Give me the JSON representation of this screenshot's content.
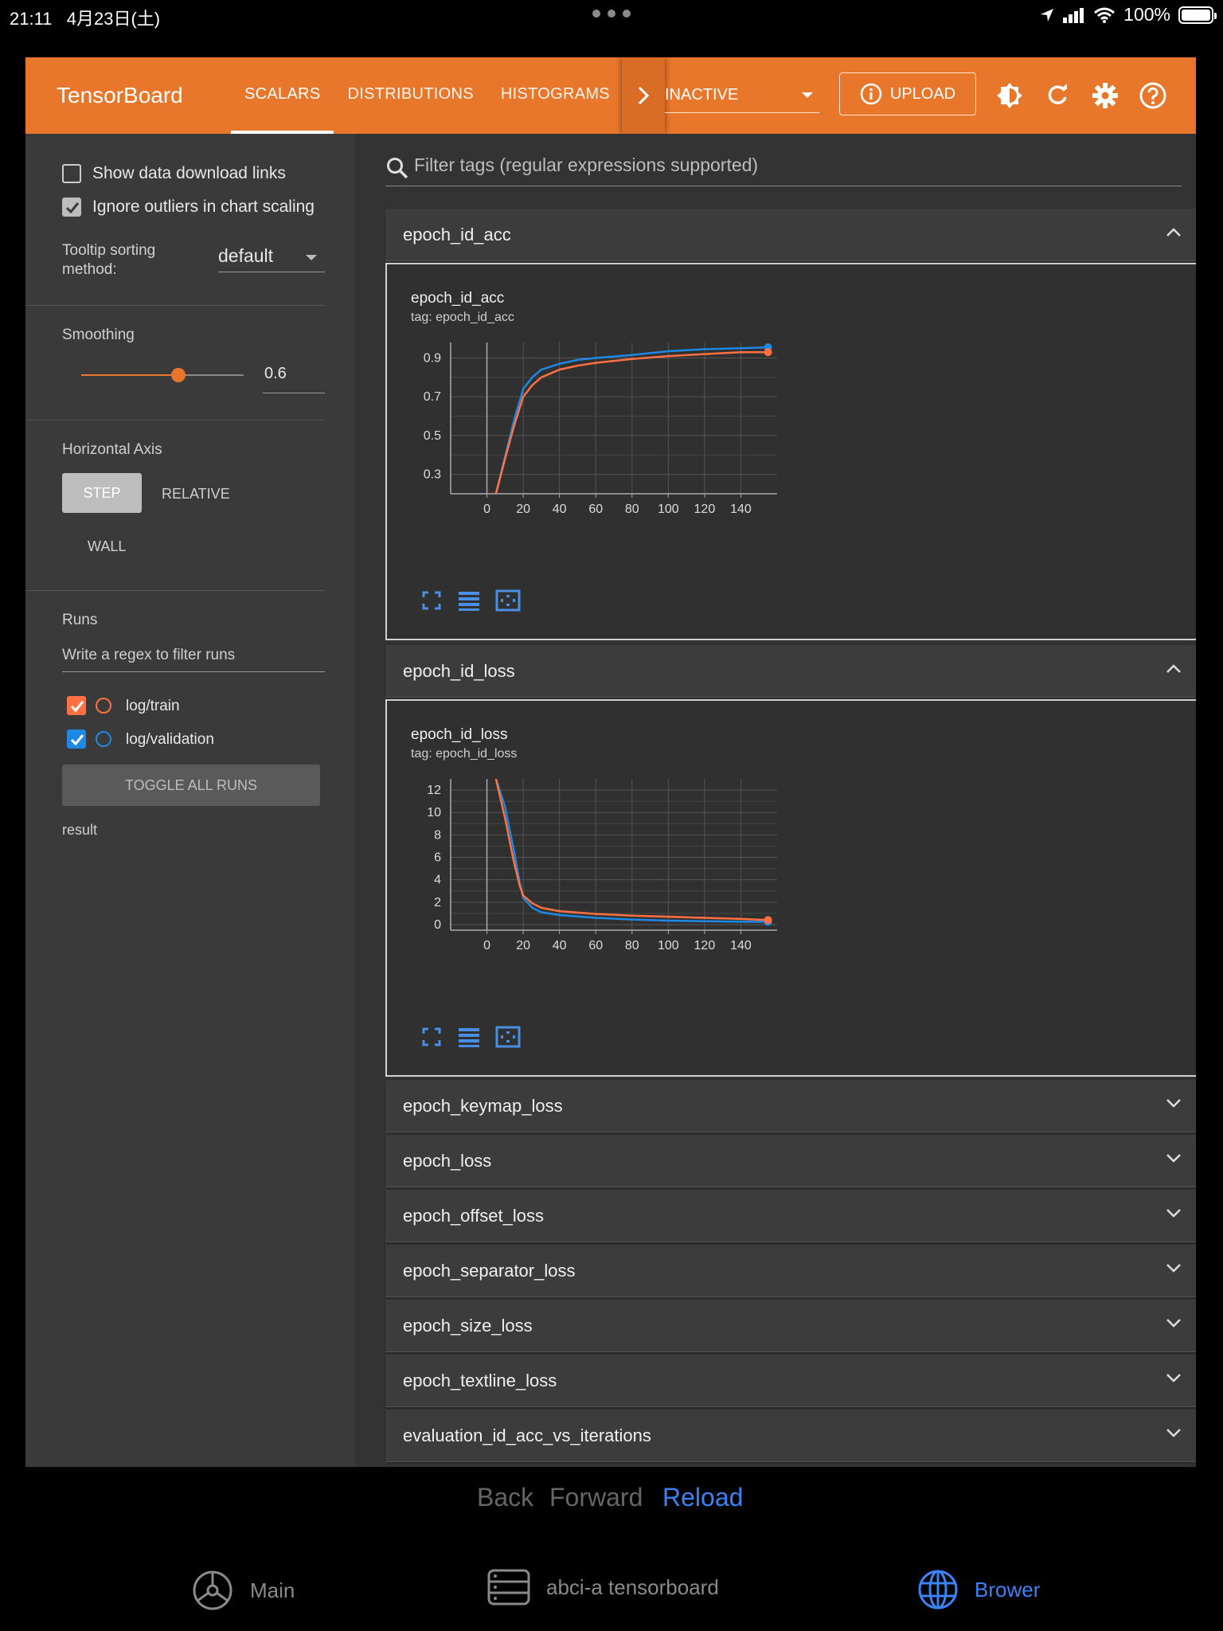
{
  "status_bar": {
    "time": "21:11",
    "date": "4月23日(土)",
    "battery": "100%"
  },
  "app": {
    "brand": "TensorBoard",
    "tabs": [
      {
        "label": "SCALARS",
        "active": true
      },
      {
        "label": "DISTRIBUTIONS",
        "active": false
      },
      {
        "label": "HISTOGRAMS",
        "active": false
      }
    ],
    "inactive_select": "INACTIVE",
    "upload_label": "UPLOAD",
    "accent": "#e8772b"
  },
  "sidebar": {
    "show_download_links": "Show data download links",
    "ignore_outliers": "Ignore outliers in chart scaling",
    "tooltip_label_1": "Tooltip sorting",
    "tooltip_label_2": "method:",
    "tooltip_value": "default",
    "smoothing_label": "Smoothing",
    "smoothing_value": "0.6",
    "smoothing_fraction": 0.6,
    "horizontal_axis_label": "Horizontal Axis",
    "axis_options": [
      "STEP",
      "RELATIVE",
      "WALL"
    ],
    "runs_label": "Runs",
    "runs_filter_placeholder": "Write a regex to filter runs",
    "runs": [
      {
        "name": "log/train",
        "color": "#ff7043",
        "checked": true
      },
      {
        "name": "log/validation",
        "color": "#1e88e5",
        "checked": true
      }
    ],
    "toggle_all": "TOGGLE ALL RUNS",
    "result": "result"
  },
  "main": {
    "filter_placeholder": "Filter tags (regular expressions supported)",
    "sections": [
      {
        "title": "epoch_id_acc",
        "expanded": true
      },
      {
        "title": "epoch_id_loss",
        "expanded": true
      },
      {
        "title": "epoch_keymap_loss",
        "expanded": false
      },
      {
        "title": "epoch_loss",
        "expanded": false
      },
      {
        "title": "epoch_offset_loss",
        "expanded": false
      },
      {
        "title": "epoch_separator_loss",
        "expanded": false
      },
      {
        "title": "epoch_size_loss",
        "expanded": false
      },
      {
        "title": "epoch_textline_loss",
        "expanded": false
      },
      {
        "title": "evaluation_id_acc_vs_iterations",
        "expanded": false
      }
    ]
  },
  "chart_data": [
    {
      "type": "line",
      "title": "epoch_id_acc",
      "subtitle": "tag: epoch_id_acc",
      "xlim": [
        -20,
        160
      ],
      "ylim": [
        0.2,
        0.98
      ],
      "xticks": [
        0,
        20,
        40,
        60,
        80,
        100,
        120,
        140
      ],
      "yticks": [
        0.3,
        0.5,
        0.7,
        0.9
      ],
      "ytick_labels": [
        "0.3",
        "0.5",
        "0.7",
        "0.9"
      ],
      "grid": true,
      "series": [
        {
          "name": "log/train",
          "color": "#ff7043",
          "x": [
            5,
            10,
            15,
            20,
            25,
            30,
            40,
            50,
            60,
            80,
            100,
            120,
            140,
            155
          ],
          "y": [
            0.2,
            0.38,
            0.55,
            0.7,
            0.76,
            0.8,
            0.84,
            0.86,
            0.875,
            0.895,
            0.91,
            0.92,
            0.93,
            0.93
          ]
        },
        {
          "name": "log/validation",
          "color": "#1e88e5",
          "x": [
            5,
            10,
            15,
            20,
            25,
            30,
            40,
            50,
            60,
            80,
            100,
            120,
            140,
            155
          ],
          "y": [
            0.2,
            0.39,
            0.58,
            0.74,
            0.8,
            0.84,
            0.87,
            0.89,
            0.9,
            0.915,
            0.935,
            0.945,
            0.95,
            0.955
          ]
        }
      ]
    },
    {
      "type": "line",
      "title": "epoch_id_loss",
      "subtitle": "tag: epoch_id_loss",
      "xlim": [
        -20,
        160
      ],
      "ylim": [
        -0.5,
        13
      ],
      "xticks": [
        0,
        20,
        40,
        60,
        80,
        100,
        120,
        140
      ],
      "yticks": [
        0,
        2,
        4,
        6,
        8,
        10,
        12
      ],
      "ytick_labels": [
        "0",
        "2",
        "4",
        "6",
        "8",
        "10",
        "12"
      ],
      "grid": true,
      "series": [
        {
          "name": "log/train",
          "color": "#ff7043",
          "x": [
            5,
            10,
            15,
            18,
            20,
            25,
            30,
            40,
            60,
            80,
            100,
            120,
            140,
            155
          ],
          "y": [
            13,
            9.5,
            5.5,
            3.5,
            2.6,
            1.9,
            1.5,
            1.2,
            0.95,
            0.8,
            0.7,
            0.6,
            0.5,
            0.4
          ]
        },
        {
          "name": "log/validation",
          "color": "#1e88e5",
          "x": [
            5,
            10,
            15,
            18,
            20,
            25,
            30,
            40,
            60,
            80,
            100,
            120,
            140,
            155
          ],
          "y": [
            13,
            10.5,
            6.5,
            3.8,
            2.4,
            1.5,
            1.1,
            0.85,
            0.6,
            0.45,
            0.35,
            0.3,
            0.25,
            0.25
          ]
        }
      ]
    }
  ],
  "browser_nav": {
    "back": "Back",
    "forward": "Forward",
    "reload": "Reload"
  },
  "tabbar": [
    {
      "label": "Main",
      "active": false
    },
    {
      "label": "abci-a tensorboard",
      "active": false
    },
    {
      "label": "Brower",
      "active": true
    }
  ]
}
